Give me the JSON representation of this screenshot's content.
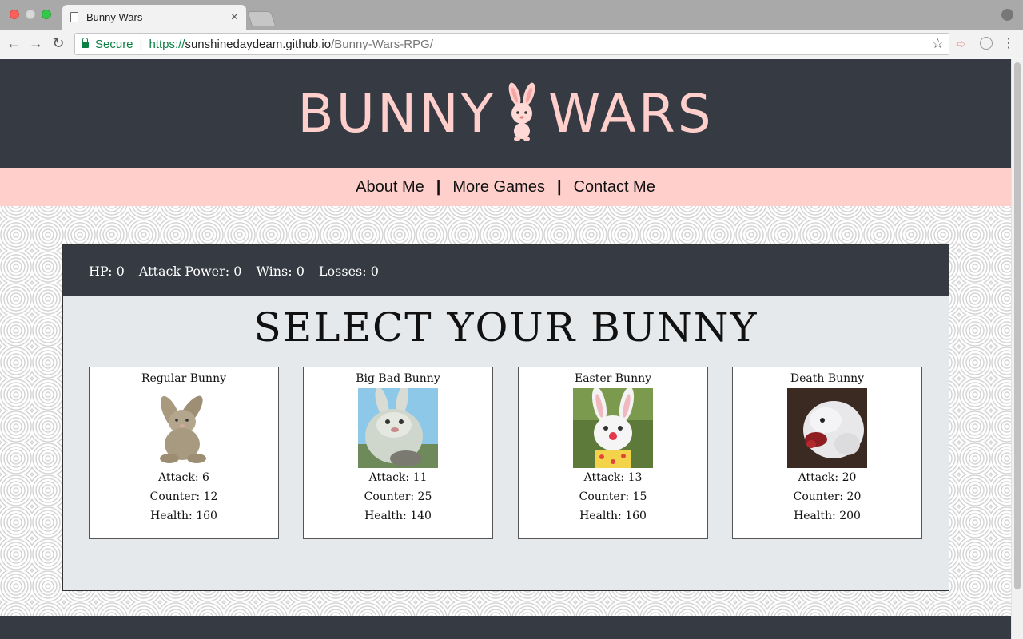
{
  "browser": {
    "tab_title": "Bunny Wars",
    "secure_label": "Secure",
    "url_https": "https://",
    "url_host": "sunshinedaydeam.github.io",
    "url_path": "/Bunny-Wars-RPG/"
  },
  "header": {
    "logo_left": "BUNNY",
    "logo_right": "WARS",
    "logo_color": "#ffcfcc",
    "bg_color": "#353a43"
  },
  "nav": {
    "links": [
      "About Me",
      "More Games",
      "Contact Me"
    ],
    "divider": "|",
    "bg_color": "#ffcfcc"
  },
  "stats": {
    "hp": "HP: 0",
    "attack_power": "Attack Power: 0",
    "wins": "Wins: 0",
    "losses": "Losses: 0"
  },
  "select_title": "SELECT YOUR BUNNY",
  "bunnies": [
    {
      "name": "Regular Bunny",
      "attack": "Attack: 6",
      "counter": "Counter: 12",
      "health": "Health: 160",
      "icon": "plush-bunny-image"
    },
    {
      "name": "Big Bad Bunny",
      "attack": "Attack: 11",
      "counter": "Counter: 25",
      "health": "Health: 140",
      "icon": "big-bunny-image"
    },
    {
      "name": "Easter Bunny",
      "attack": "Attack: 13",
      "counter": "Counter: 15",
      "health": "Health: 160",
      "icon": "easter-bunny-image"
    },
    {
      "name": "Death Bunny",
      "attack": "Attack: 20",
      "counter": "Counter: 20",
      "health": "Health: 200",
      "icon": "death-bunny-image"
    }
  ]
}
